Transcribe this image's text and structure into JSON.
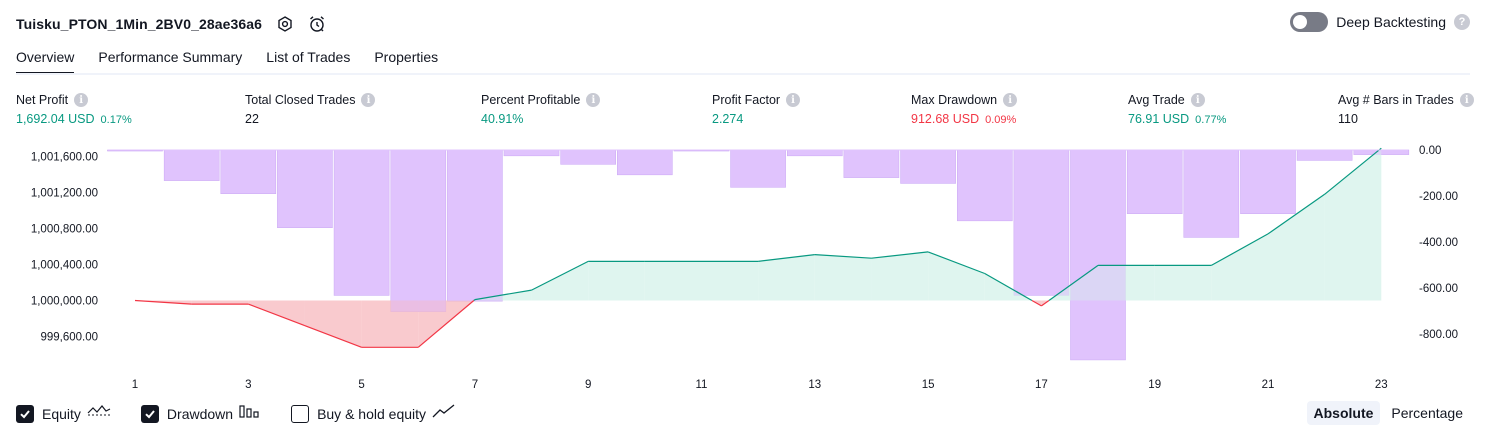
{
  "header": {
    "title": "Tuisku_PTON_1Min_2BV0_28ae36a6",
    "deep_backtesting_label": "Deep Backtesting",
    "deep_backtesting_enabled": false
  },
  "tabs": [
    {
      "label": "Overview",
      "active": true
    },
    {
      "label": "Performance Summary",
      "active": false
    },
    {
      "label": "List of Trades",
      "active": false
    },
    {
      "label": "Properties",
      "active": false
    }
  ],
  "metrics": [
    {
      "label": "Net Profit",
      "value": "1,692.04 USD",
      "pct": "0.17%",
      "tone": "pos"
    },
    {
      "label": "Total Closed Trades",
      "value": "22",
      "pct": "",
      "tone": "neu"
    },
    {
      "label": "Percent Profitable",
      "value": "40.91%",
      "pct": "",
      "tone": "pos"
    },
    {
      "label": "Profit Factor",
      "value": "2.274",
      "pct": "",
      "tone": "pos"
    },
    {
      "label": "Max Drawdown",
      "value": "912.68 USD",
      "pct": "0.09%",
      "tone": "neg"
    },
    {
      "label": "Avg Trade",
      "value": "76.91 USD",
      "pct": "0.77%",
      "tone": "pos"
    },
    {
      "label": "Avg # Bars in Trades",
      "value": "110",
      "pct": "",
      "tone": "neu"
    }
  ],
  "chart_data": {
    "type": "line",
    "x": [
      1,
      2,
      3,
      4,
      5,
      6,
      7,
      8,
      9,
      10,
      11,
      12,
      13,
      14,
      15,
      16,
      17,
      18,
      19,
      20,
      21,
      22,
      23
    ],
    "x_tick_labels": [
      "1",
      "3",
      "5",
      "7",
      "9",
      "11",
      "13",
      "15",
      "17",
      "19",
      "21",
      "23"
    ],
    "series": [
      {
        "name": "Equity",
        "axis": "left",
        "values": [
          1000000,
          999960,
          999960,
          999720,
          999480,
          999480,
          1000010,
          1000115,
          1000435,
          1000435,
          1000435,
          1000435,
          1000510,
          1000470,
          1000540,
          1000300,
          999940,
          1000390,
          1000390,
          1000390,
          1000740,
          1001180,
          1001692.04
        ]
      },
      {
        "name": "Drawdown",
        "axis": "right",
        "type": "bar",
        "values": [
          0,
          -133,
          -190,
          -338,
          -632,
          -703,
          -657,
          -25,
          -62,
          -108,
          0,
          -162,
          -25,
          -120,
          -145,
          -308,
          -632,
          -912.68,
          -277,
          -380,
          -277,
          -45,
          -20
        ]
      }
    ],
    "left_axis": {
      "ticks": [
        "999,600.00",
        "1,000,000.00",
        "1,000,400.00",
        "1,000,800.00",
        "1,001,200.00",
        "1,001,600.00"
      ],
      "range": [
        999440,
        1001720
      ]
    },
    "right_axis": {
      "ticks": [
        "0.00",
        "-200.00",
        "-400.00",
        "-600.00",
        "-800.00"
      ],
      "range": [
        -920,
        10
      ]
    },
    "colors": {
      "equity_up": "#089981",
      "equity_down": "#f23645",
      "equity_fill": "#d4f2ea",
      "drawdown_fill": "#f7b8bd",
      "drawdown_bar": "#e1c4fd",
      "bar_border": "#c9a7f4"
    }
  },
  "legend": [
    {
      "label": "Equity",
      "checked": true,
      "icon": "equity-icon"
    },
    {
      "label": "Drawdown",
      "checked": true,
      "icon": "drawdown-bars-icon"
    },
    {
      "label": "Buy & hold equity",
      "checked": false,
      "icon": "buy-hold-line-icon"
    }
  ],
  "mode": {
    "absolute_label": "Absolute",
    "percentage_label": "Percentage",
    "selected": "Absolute"
  }
}
